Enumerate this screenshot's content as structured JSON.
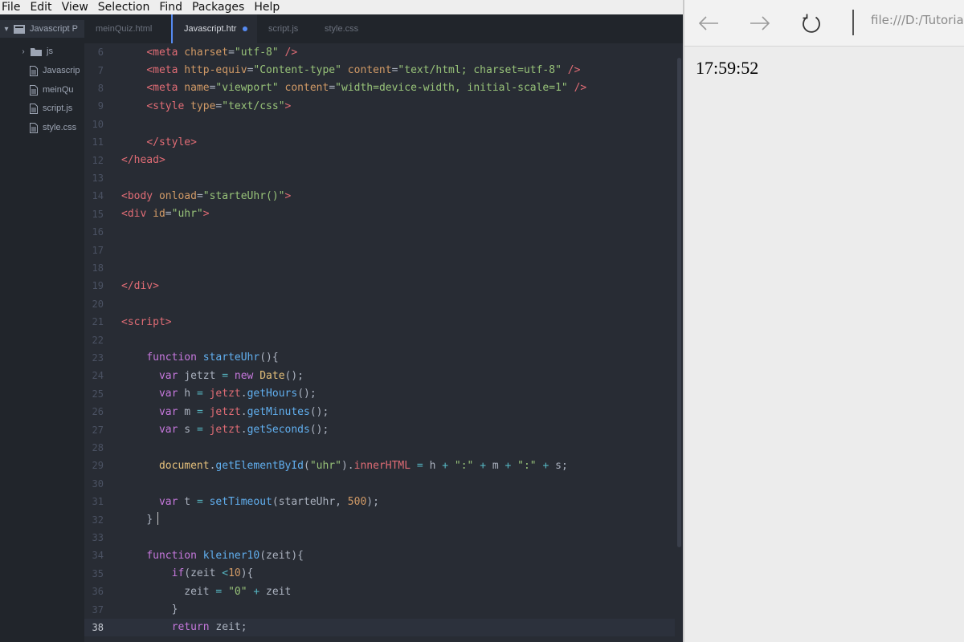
{
  "menu": [
    "File",
    "Edit",
    "View",
    "Selection",
    "Find",
    "Packages",
    "Help"
  ],
  "tree": {
    "project": "Javascript P",
    "items": [
      {
        "type": "folder",
        "label": "js"
      },
      {
        "type": "file",
        "label": "Javascrip"
      },
      {
        "type": "file",
        "label": "meinQu"
      },
      {
        "type": "file",
        "label": "script.js"
      },
      {
        "type": "file",
        "label": "style.css"
      }
    ]
  },
  "tabs": [
    {
      "label": "meinQuiz.html",
      "active": false
    },
    {
      "label": "Javascript.htr",
      "active": true,
      "modified": true
    },
    {
      "label": "script.js",
      "active": false
    },
    {
      "label": "style.css",
      "active": false
    }
  ],
  "code": {
    "current_line": "38",
    "lines": [
      {
        "n": "6",
        "t": [
          [
            "    ",
            "p"
          ],
          [
            "<meta ",
            "tag"
          ],
          [
            "charset",
            "attr"
          ],
          [
            "=",
            "p"
          ],
          [
            "\"utf-8\"",
            "str"
          ],
          [
            " />",
            "tag"
          ]
        ]
      },
      {
        "n": "7",
        "t": [
          [
            "    ",
            "p"
          ],
          [
            "<meta ",
            "tag"
          ],
          [
            "http-equiv",
            "attr"
          ],
          [
            "=",
            "p"
          ],
          [
            "\"Content-type\"",
            "str"
          ],
          [
            " ",
            "p"
          ],
          [
            "content",
            "attr"
          ],
          [
            "=",
            "p"
          ],
          [
            "\"text/html; charset=utf-8\"",
            "str"
          ],
          [
            " />",
            "tag"
          ]
        ]
      },
      {
        "n": "8",
        "t": [
          [
            "    ",
            "p"
          ],
          [
            "<meta ",
            "tag"
          ],
          [
            "name",
            "attr"
          ],
          [
            "=",
            "p"
          ],
          [
            "\"viewport\"",
            "str"
          ],
          [
            " ",
            "p"
          ],
          [
            "content",
            "attr"
          ],
          [
            "=",
            "p"
          ],
          [
            "\"width=device-width, initial-scale=1\"",
            "str"
          ],
          [
            " />",
            "tag"
          ]
        ]
      },
      {
        "n": "9",
        "t": [
          [
            "    ",
            "p"
          ],
          [
            "<style ",
            "tag"
          ],
          [
            "type",
            "attr"
          ],
          [
            "=",
            "p"
          ],
          [
            "\"text/css\"",
            "str"
          ],
          [
            ">",
            "tag"
          ]
        ]
      },
      {
        "n": "10",
        "t": []
      },
      {
        "n": "11",
        "t": [
          [
            "    ",
            "p"
          ],
          [
            "</style>",
            "tag"
          ]
        ]
      },
      {
        "n": "12",
        "t": [
          [
            "</head>",
            "tag"
          ]
        ]
      },
      {
        "n": "13",
        "t": []
      },
      {
        "n": "14",
        "t": [
          [
            "<body ",
            "tag"
          ],
          [
            "onload",
            "attr"
          ],
          [
            "=",
            "p"
          ],
          [
            "\"starteUhr()\"",
            "str"
          ],
          [
            ">",
            "tag"
          ]
        ]
      },
      {
        "n": "15",
        "t": [
          [
            "<div ",
            "tag"
          ],
          [
            "id",
            "attr"
          ],
          [
            "=",
            "p"
          ],
          [
            "\"uhr\"",
            "str"
          ],
          [
            ">",
            "tag"
          ]
        ]
      },
      {
        "n": "16",
        "t": []
      },
      {
        "n": "17",
        "t": []
      },
      {
        "n": "18",
        "t": []
      },
      {
        "n": "19",
        "t": [
          [
            "</div>",
            "tag"
          ]
        ]
      },
      {
        "n": "20",
        "t": []
      },
      {
        "n": "21",
        "t": [
          [
            "<script>",
            "tag"
          ]
        ]
      },
      {
        "n": "22",
        "t": []
      },
      {
        "n": "23",
        "t": [
          [
            "    ",
            "p"
          ],
          [
            "function ",
            "kw"
          ],
          [
            "starteUhr",
            "fn"
          ],
          [
            "(){",
            "p"
          ]
        ]
      },
      {
        "n": "24",
        "t": [
          [
            "      ",
            "p"
          ],
          [
            "var ",
            "kw"
          ],
          [
            "jetzt ",
            "p"
          ],
          [
            "= ",
            "op"
          ],
          [
            "new ",
            "kw"
          ],
          [
            "Date",
            "cls"
          ],
          [
            "();",
            "p"
          ]
        ]
      },
      {
        "n": "25",
        "t": [
          [
            "      ",
            "p"
          ],
          [
            "var ",
            "kw"
          ],
          [
            "h ",
            "p"
          ],
          [
            "= ",
            "op"
          ],
          [
            "jetzt",
            "obj"
          ],
          [
            ".",
            "p"
          ],
          [
            "getHours",
            "fn"
          ],
          [
            "();",
            "p"
          ]
        ]
      },
      {
        "n": "26",
        "t": [
          [
            "      ",
            "p"
          ],
          [
            "var ",
            "kw"
          ],
          [
            "m ",
            "p"
          ],
          [
            "= ",
            "op"
          ],
          [
            "jetzt",
            "obj"
          ],
          [
            ".",
            "p"
          ],
          [
            "getMinutes",
            "fn"
          ],
          [
            "();",
            "p"
          ]
        ]
      },
      {
        "n": "27",
        "t": [
          [
            "      ",
            "p"
          ],
          [
            "var ",
            "kw"
          ],
          [
            "s ",
            "p"
          ],
          [
            "= ",
            "op"
          ],
          [
            "jetzt",
            "obj"
          ],
          [
            ".",
            "p"
          ],
          [
            "getSeconds",
            "fn"
          ],
          [
            "();",
            "p"
          ]
        ]
      },
      {
        "n": "28",
        "t": []
      },
      {
        "n": "29",
        "t": [
          [
            "      ",
            "p"
          ],
          [
            "document",
            "doc"
          ],
          [
            ".",
            "p"
          ],
          [
            "getElementById",
            "fn"
          ],
          [
            "(",
            "p"
          ],
          [
            "\"uhr\"",
            "str"
          ],
          [
            ").",
            "p"
          ],
          [
            "innerHTML ",
            "obj"
          ],
          [
            "= ",
            "op"
          ],
          [
            "h ",
            "p"
          ],
          [
            "+ ",
            "op"
          ],
          [
            "\":\" ",
            "str"
          ],
          [
            "+ ",
            "op"
          ],
          [
            "m ",
            "p"
          ],
          [
            "+ ",
            "op"
          ],
          [
            "\":\" ",
            "str"
          ],
          [
            "+ ",
            "op"
          ],
          [
            "s;",
            "p"
          ]
        ]
      },
      {
        "n": "30",
        "t": []
      },
      {
        "n": "31",
        "t": [
          [
            "      ",
            "p"
          ],
          [
            "var ",
            "kw"
          ],
          [
            "t ",
            "p"
          ],
          [
            "= ",
            "op"
          ],
          [
            "setTimeout",
            "fn"
          ],
          [
            "(starteUhr, ",
            "p"
          ],
          [
            "500",
            "num"
          ],
          [
            ");",
            "p"
          ]
        ]
      },
      {
        "n": "32",
        "t": [
          [
            "    ",
            "p"
          ],
          [
            "}",
            "p"
          ]
        ]
      },
      {
        "n": "33",
        "t": []
      },
      {
        "n": "34",
        "t": [
          [
            "    ",
            "p"
          ],
          [
            "function ",
            "kw"
          ],
          [
            "kleiner10",
            "fn"
          ],
          [
            "(zeit){",
            "p"
          ]
        ]
      },
      {
        "n": "35",
        "t": [
          [
            "        ",
            "p"
          ],
          [
            "if",
            "kw"
          ],
          [
            "(zeit ",
            "p"
          ],
          [
            "<",
            "op"
          ],
          [
            "10",
            "num"
          ],
          [
            "){",
            "p"
          ]
        ]
      },
      {
        "n": "36",
        "t": [
          [
            "          ",
            "p"
          ],
          [
            "zeit ",
            "p"
          ],
          [
            "= ",
            "op"
          ],
          [
            "\"0\" ",
            "str"
          ],
          [
            "+ ",
            "op"
          ],
          [
            "zeit",
            "p"
          ]
        ]
      },
      {
        "n": "37",
        "t": [
          [
            "        ",
            "p"
          ],
          [
            "}",
            "p"
          ]
        ]
      },
      {
        "n": "38",
        "t": [
          [
            "        ",
            "p"
          ],
          [
            "return ",
            "kw"
          ],
          [
            "zeit;",
            "p"
          ]
        ]
      }
    ]
  },
  "browser": {
    "address": "file:///D:/Tutoria",
    "clock_text": "17:59:52"
  },
  "colors": {
    "editor_bg": "#282c34",
    "tree_bg": "#21252b",
    "accent": "#568af2"
  },
  "icons": {
    "back": "arrow-left-icon",
    "forward": "arrow-right-icon",
    "reload": "reload-icon"
  }
}
